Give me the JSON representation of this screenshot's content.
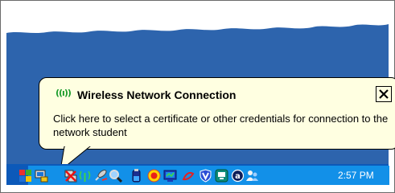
{
  "balloon": {
    "title": "Wireless Network Connection",
    "message": "Click here to select a certificate or other credentials for connection to the network student",
    "title_icon": "wireless-signal-icon",
    "close_icon": "close-icon"
  },
  "taskbar": {
    "clock": "2:57 PM",
    "tray_icons": [
      "show-hidden-icons-icon",
      "network-connection-icon",
      "network-disconnected-icon",
      "wireless-signal-icon",
      "satellite-icon",
      "magnifier-icon",
      "battery-icon",
      "antivirus-icon",
      "monitor-icon",
      "bluetooth-icon",
      "shield-icon",
      "display-settings-icon",
      "audio-icon",
      "messenger-icon"
    ]
  },
  "colors": {
    "desktop": "#2d64ad",
    "balloon_background": "#ffffe1",
    "taskbar": "#0c59b9",
    "tray": "#1290e8"
  }
}
